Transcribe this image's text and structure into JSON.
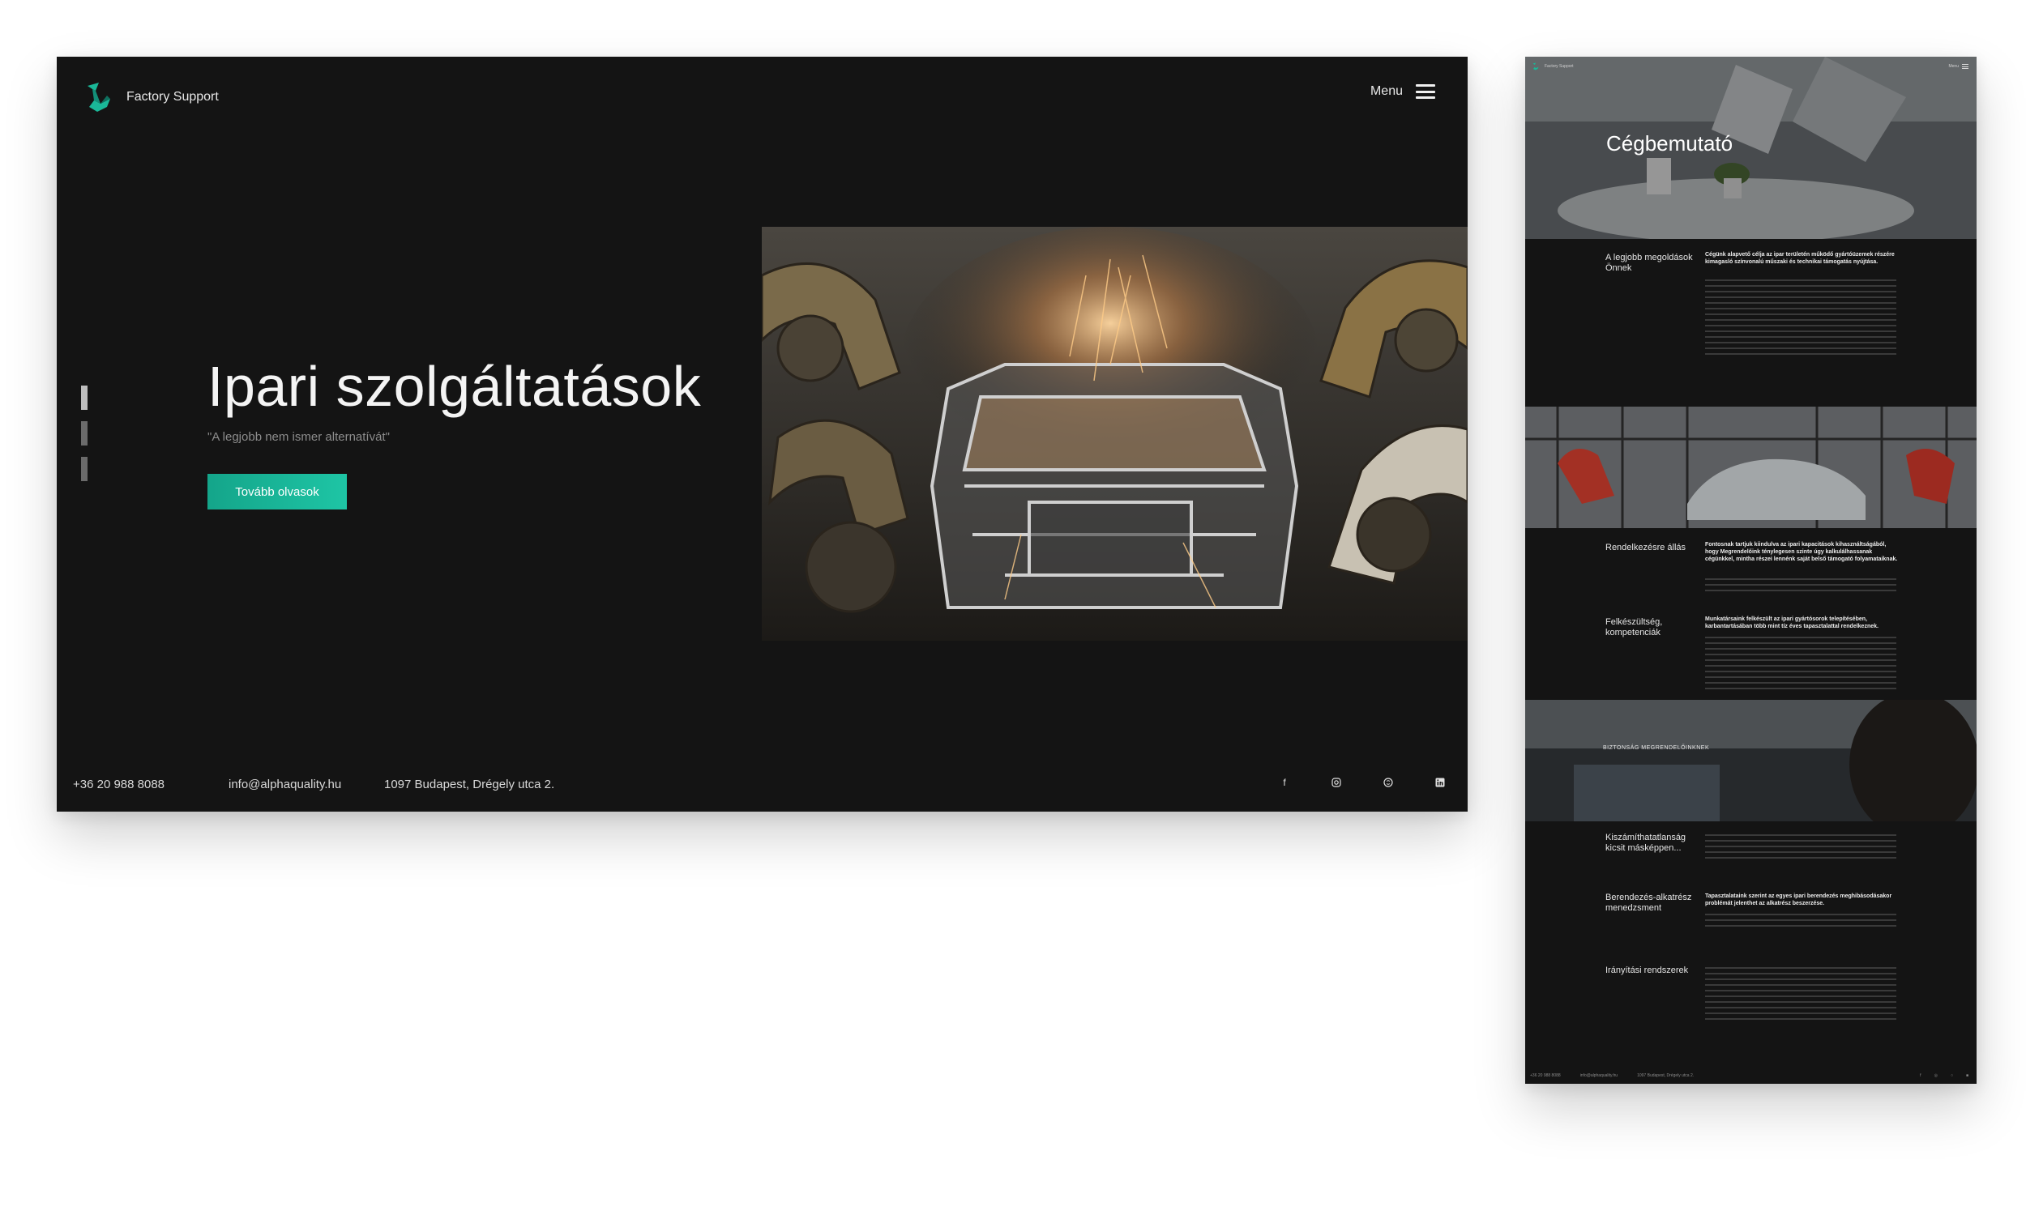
{
  "desktop": {
    "brand": "Factory Support",
    "menu_label": "Menu",
    "hero_title": "Ipari szolgáltatások",
    "hero_quote": "\"A legjobb nem ismer alternatívát\"",
    "cta_label": "Tovább olvasok",
    "footer": {
      "phone": "+36 20 988 8088",
      "email": "info@alphaquality.hu",
      "address": "1097 Budapest, Drégely utca 2."
    },
    "socials": [
      "facebook-icon",
      "instagram-icon",
      "skype-icon",
      "linkedin-icon"
    ],
    "slide_indicator_count": 3
  },
  "mobile": {
    "title": "Cégbemutató",
    "sections": [
      {
        "label": "A legjobb megoldások Önnek",
        "lead": "Cégünk alapvető célja az ipar területén működő gyártóüzemek részére kimagasló színvonalú műszaki és technikai támogatás nyújtása."
      },
      {
        "label": "Rendelkezésre állás",
        "lead": "Fontosnak tartjuk kiindulva az ipari kapacitások kihasználtságából, hogy Megrendelőink ténylegesen szinte úgy kalkulálhassanak cégünkkel, mintha részei lennénk saját belső támogató folyamataiknak."
      },
      {
        "label": "Felkészültség, kompetenciák",
        "lead": "Munkatársaink felkészült az ipari gyártósorok telepítésében, karbantartásában több mint tíz éves tapasztalattal rendelkeznek."
      },
      {
        "label": "Kiszámíthatatlanság kicsit másképpen...",
        "lead": ""
      },
      {
        "label": "Berendezés-alkatrész menedzsment",
        "lead": "Tapasztalataink szerint az egyes ipari berendezés meghibásodásakor problémát jelenthet az alkatrész beszerzése."
      },
      {
        "label": "Irányítási rendszerek",
        "lead": ""
      }
    ],
    "security_title": "BIZTONSÁG MEGRENDELŐINKNEK"
  },
  "colors": {
    "panel_bg": "#141414",
    "accent": "#1ab898",
    "text": "#f4f4f4",
    "muted": "#8c8c8c"
  }
}
